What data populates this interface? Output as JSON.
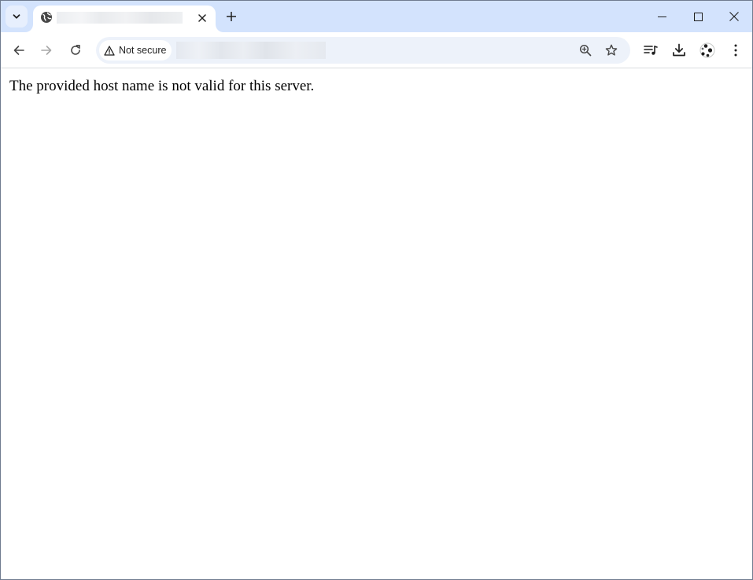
{
  "browser": {
    "tab": {
      "title": "",
      "favicon": "globe-icon"
    },
    "window_controls": [
      "minimize-icon",
      "maximize-icon",
      "close-icon"
    ],
    "toolbar": {
      "back_icon": "arrow-left-icon",
      "forward_icon": "arrow-right-icon",
      "reload_icon": "reload-icon",
      "security_label": "Not secure",
      "security_icon": "warning-triangle-icon",
      "url": "",
      "zoom_icon": "zoom-in-icon",
      "bookmark_icon": "star-icon",
      "media_icon": "media-playlist-icon",
      "download_icon": "download-icon",
      "profile_icon": "extension-puzzle-icon",
      "menu_icon": "kebab-menu-icon"
    },
    "colors": {
      "tabstrip": "#d3e3fd",
      "omnibox": "#edf2fa",
      "icon": "#474747"
    }
  },
  "page": {
    "message": "The provided host name is not valid for this server."
  }
}
